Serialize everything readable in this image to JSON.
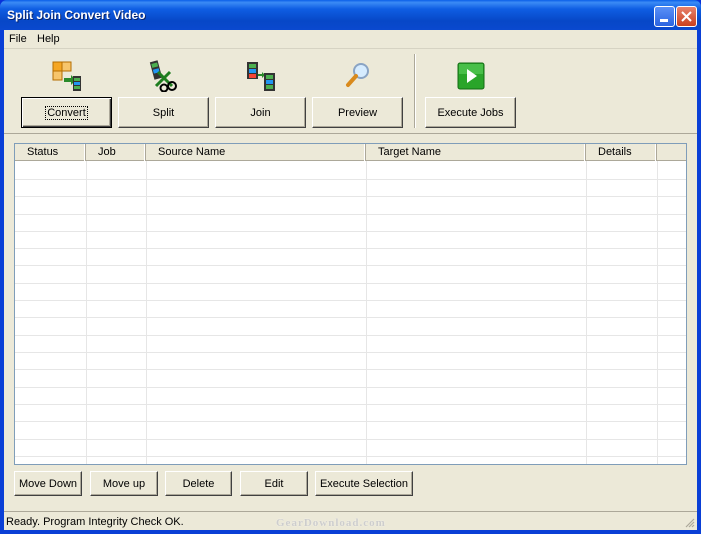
{
  "window": {
    "title": "Split Join Convert Video"
  },
  "menu": {
    "items": [
      "File",
      "Help"
    ]
  },
  "toolbar": {
    "convert_label": "Convert",
    "split_label": "Split",
    "join_label": "Join",
    "preview_label": "Preview",
    "execute_jobs_label": "Execute Jobs"
  },
  "table": {
    "columns": [
      "Status",
      "Job",
      "Source Name",
      "Target Name",
      "Details"
    ],
    "rows": []
  },
  "actions": {
    "move_down_label": "Move Down",
    "move_up_label": "Move up",
    "delete_label": "Delete",
    "edit_label": "Edit",
    "execute_selection_label": "Execute Selection"
  },
  "status": {
    "text": "Ready. Program Integrity Check OK."
  },
  "watermark": {
    "text": "GearDownload.com"
  },
  "icons": {
    "convert": "convert-icon",
    "split": "scissors-icon",
    "join": "join-film-icon",
    "preview": "magnifier-icon",
    "execute": "play-icon"
  },
  "colors": {
    "titlebar": "#0a5fe8",
    "face": "#ece9d8",
    "list_border": "#7f9db9",
    "play_green": "#2aa52a"
  }
}
